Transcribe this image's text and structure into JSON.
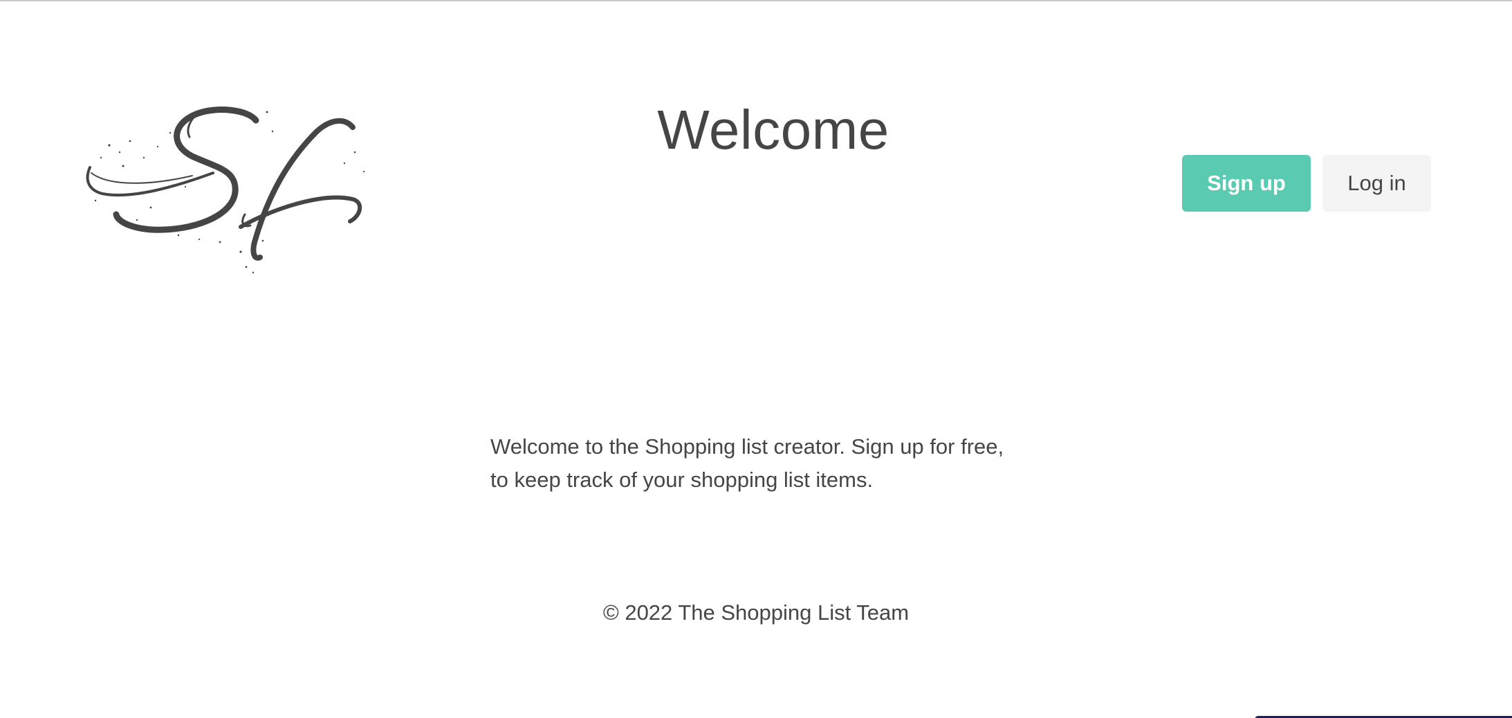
{
  "brand": {
    "logo_icon": "sf-monogram-logo"
  },
  "header": {
    "title": "Welcome"
  },
  "auth": {
    "signup_label": "Sign up",
    "login_label": "Log in",
    "signup_color": "#5acbb1",
    "login_color": "#f4f4f4"
  },
  "main": {
    "intro_text": "Welcome to the Shopping list creator. Sign up for free, to keep track of your shopping list items."
  },
  "footer": {
    "copyright": "© 2022 The Shopping List Team"
  }
}
